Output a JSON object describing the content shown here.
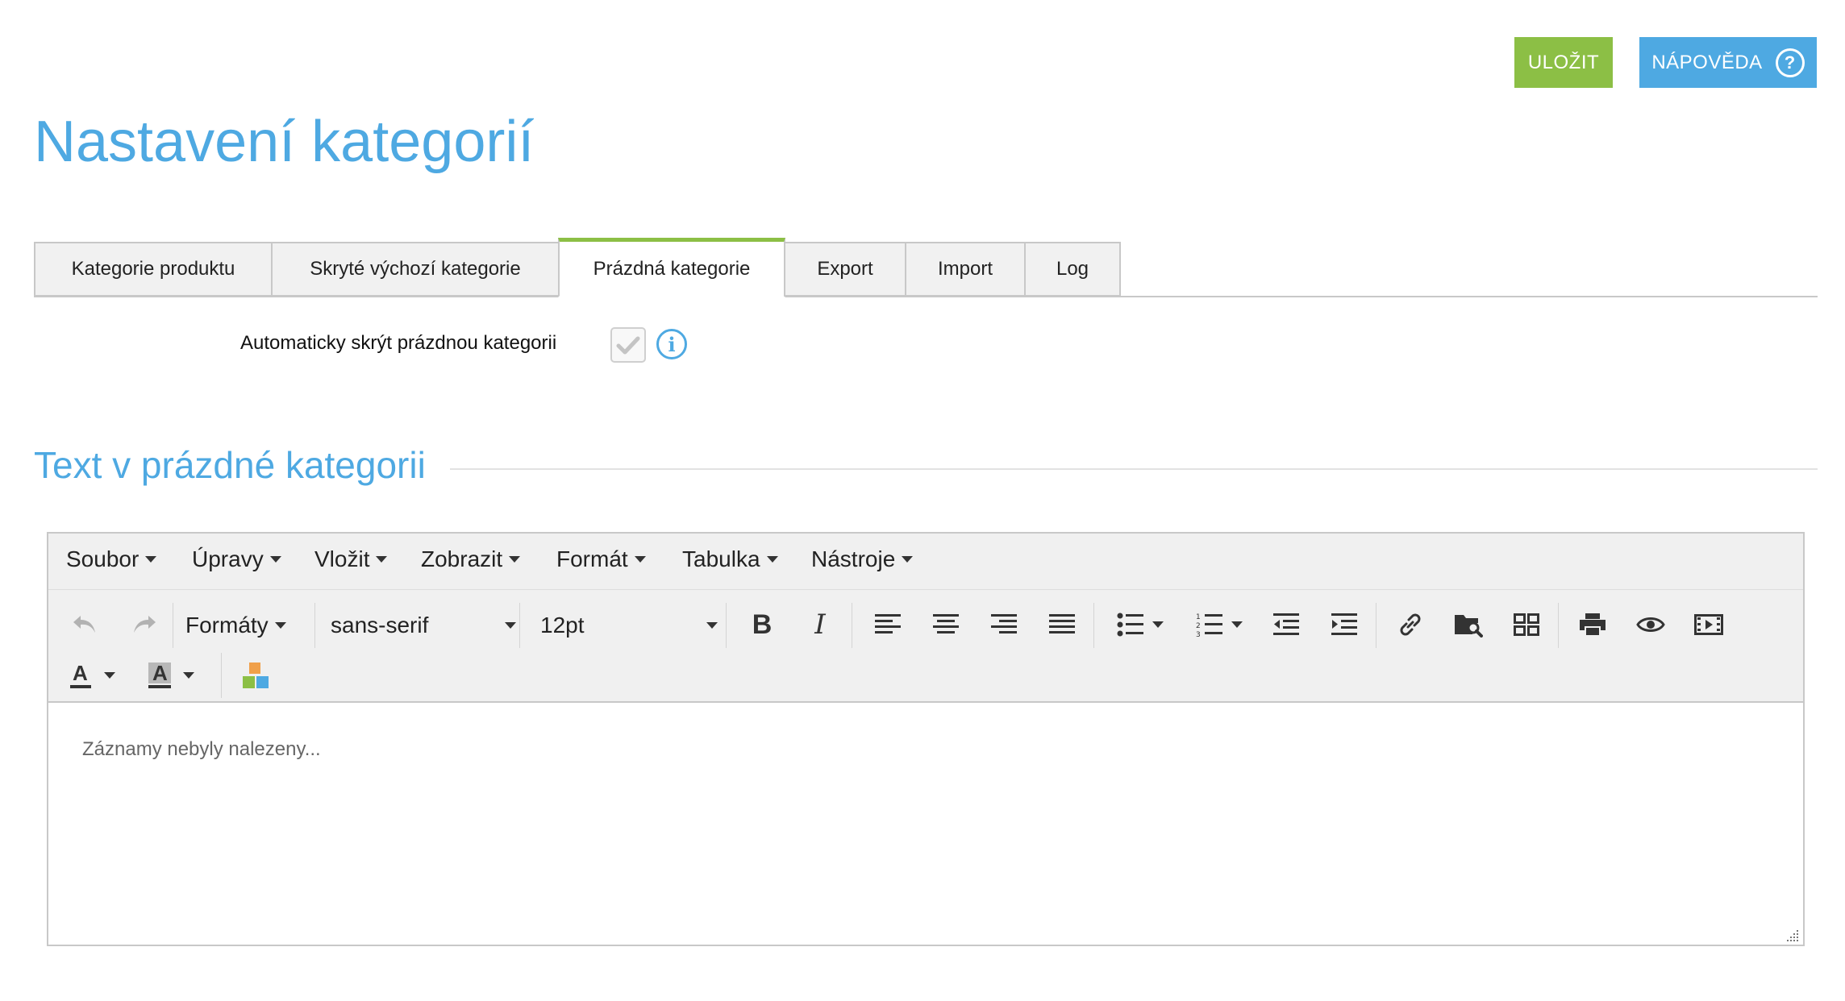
{
  "header": {
    "save_label": "ULOŽIT",
    "help_label": "NÁPOVĚDA",
    "page_title": "Nastavení kategorií"
  },
  "tabs": [
    {
      "label": "Kategorie produktu",
      "active": false
    },
    {
      "label": "Skryté výchozí kategorie",
      "active": false
    },
    {
      "label": "Prázdná kategorie",
      "active": true
    },
    {
      "label": "Export",
      "active": false
    },
    {
      "label": "Import",
      "active": false
    },
    {
      "label": "Log",
      "active": false
    }
  ],
  "option": {
    "label": "Automaticky skrýt prázdnou kategorii",
    "checked": true
  },
  "section": {
    "title": "Text v prázdné kategorii"
  },
  "editor": {
    "menu": [
      "Soubor",
      "Úpravy",
      "Vložit",
      "Zobrazit",
      "Formát",
      "Tabulka",
      "Nástroje"
    ],
    "formats_label": "Formáty",
    "font_family": "sans-serif",
    "font_size": "12pt",
    "content": "Záznamy nebyly nalezeny..."
  },
  "colors": {
    "accent_blue": "#4ea9e2",
    "accent_green": "#8cbf45"
  }
}
